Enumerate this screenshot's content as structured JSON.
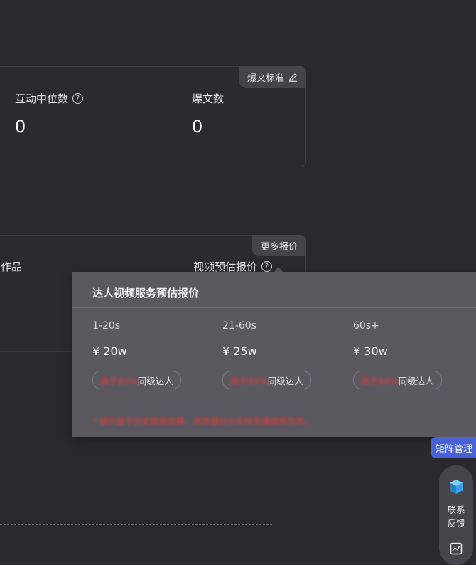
{
  "top_panel": {
    "tag": "爆文标准",
    "metrics": [
      {
        "label": "互动中位数",
        "value": "0"
      },
      {
        "label": "爆文数",
        "value": "0"
      }
    ]
  },
  "mid_panel": {
    "tag": "更多报价",
    "left_label": "作品",
    "right_label": "视频预估报价"
  },
  "popover": {
    "title": "达人视频服务预估报价",
    "columns": [
      {
        "duration": "1-20s",
        "price": "¥ 20w",
        "badge_highlight": "高于80%",
        "badge_text": "同级达人"
      },
      {
        "duration": "21-60s",
        "price": "¥ 25w",
        "badge_highlight": "高于80%",
        "badge_text": "同级达人"
      },
      {
        "duration": "60s+",
        "price": "¥ 30w",
        "badge_highlight": "高于80%",
        "badge_text": "同级达人"
      }
    ],
    "note": "* 报价基于历史数据估算，具体报价以实际沟通结果为准。"
  },
  "side": {
    "matrix_button": "矩阵管理",
    "feedback_line1": "联系",
    "feedback_line2": "反馈"
  },
  "colors": {
    "background": "#2a292e",
    "popover": "#5a5960",
    "accent_blue": "#4a62d9",
    "highlight_red": "#e23b3b"
  }
}
